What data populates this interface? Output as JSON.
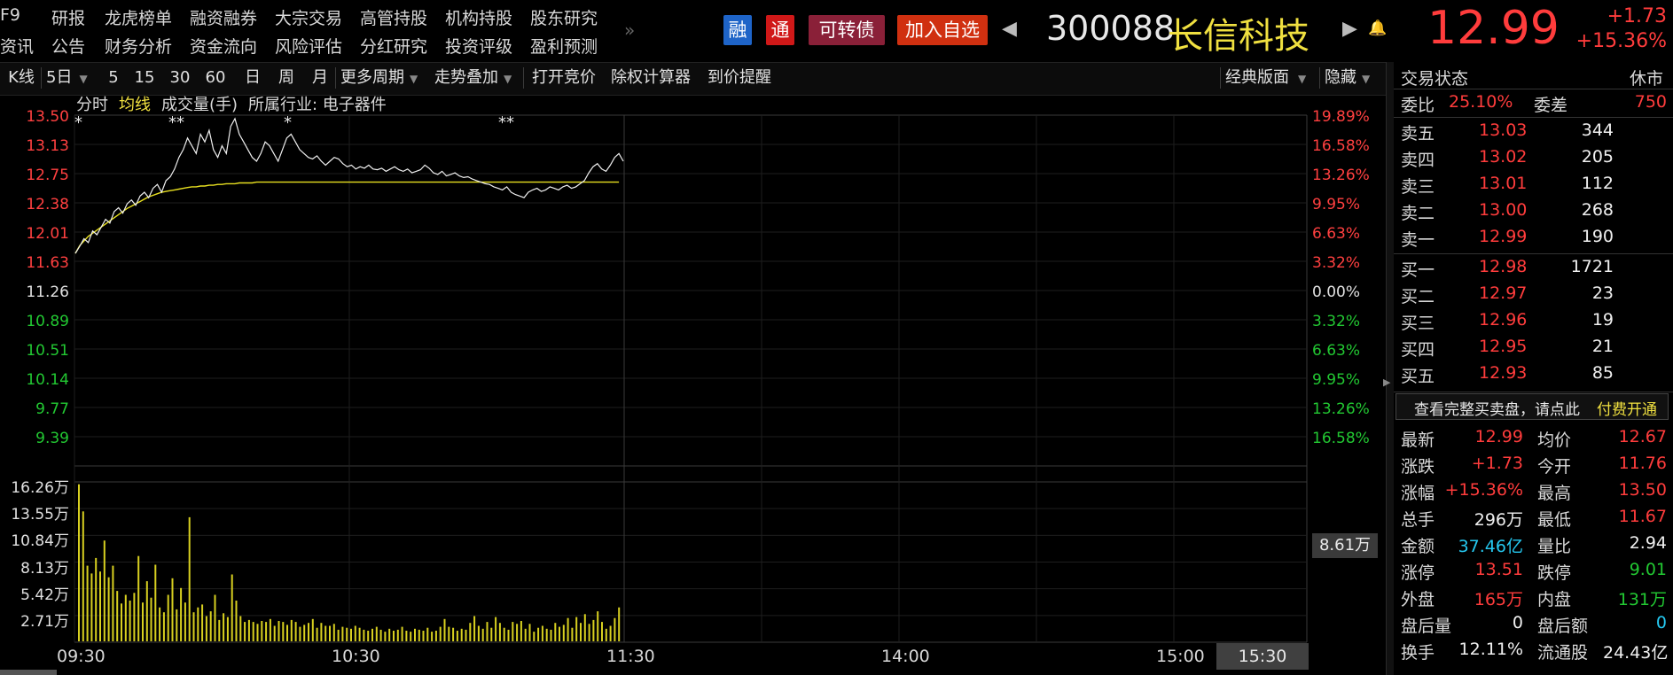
{
  "nav": {
    "row1": [
      "F9",
      "研报",
      "龙虎榜单",
      "融资融券",
      "大宗交易",
      "高管持股",
      "机构持股",
      "股东研究"
    ],
    "row2": [
      "资讯",
      "公告",
      "财务分析",
      "资金流向",
      "风险评估",
      "分红研究",
      "投资评级",
      "盈利预测"
    ],
    "more": "»"
  },
  "header": {
    "badge_rong": "融",
    "badge_tong": "通",
    "badge_convertible": "可转债",
    "add_watchlist": "加入自选",
    "prev_arrow": "◀",
    "next_arrow": "▶",
    "code": "300088",
    "name": "长信科技",
    "bell": "🔔",
    "price": "12.99",
    "change": "+1.73",
    "change_pct": "+15.36%"
  },
  "toolbar": {
    "kline": "K线",
    "period": "5日",
    "p5": "5",
    "p15": "15",
    "p30": "30",
    "p60": "60",
    "day": "日",
    "week": "周",
    "month": "月",
    "more_period": "更多周期",
    "overlay": "走势叠加",
    "auction": "打开竞价",
    "calc": "除权计算器",
    "alert": "到价提醒",
    "layout": "经典版面",
    "hide": "隐藏"
  },
  "chart_header": {
    "tab_timeshare": "分时",
    "tab_avg": "均线",
    "volume_label": "成交量(手)",
    "industry": "所属行业: 电子器件"
  },
  "chart_data": {
    "type": "line",
    "price_axis": [
      "13.50",
      "13.13",
      "12.75",
      "12.38",
      "12.01",
      "11.63",
      "11.26",
      "10.89",
      "10.51",
      "10.14",
      "9.77",
      "9.39"
    ],
    "pct_axis": [
      "19.89%",
      "16.58%",
      "13.26%",
      "9.95%",
      "6.63%",
      "3.32%",
      "0.00%",
      "3.32%",
      "6.63%",
      "9.95%",
      "13.26%",
      "16.58%"
    ],
    "volume_axis": [
      "16.26万",
      "13.55万",
      "10.84万",
      "8.13万",
      "5.42万",
      "2.71万"
    ],
    "volume_marker": "8.61万",
    "time_labels": [
      "09:30",
      "10:30",
      "11:30",
      "14:00",
      "15:00"
    ],
    "current_time": "15:30",
    "ylim": [
      9.2,
      13.6
    ],
    "prev_close": 11.26,
    "price": [
      11.76,
      11.85,
      11.95,
      11.9,
      12.05,
      12.0,
      12.1,
      12.2,
      12.15,
      12.3,
      12.35,
      12.28,
      12.4,
      12.45,
      12.38,
      12.5,
      12.55,
      12.48,
      12.6,
      12.65,
      12.55,
      12.7,
      12.75,
      12.85,
      13.0,
      13.1,
      13.25,
      13.15,
      13.05,
      13.3,
      13.2,
      13.35,
      13.1,
      13.0,
      13.15,
      13.05,
      13.4,
      13.5,
      13.3,
      13.2,
      13.1,
      13.0,
      12.95,
      13.05,
      13.2,
      13.15,
      13.05,
      12.95,
      13.1,
      13.25,
      13.3,
      13.2,
      13.1,
      13.05,
      13.0,
      12.98,
      13.02,
      12.95,
      12.9,
      12.95,
      13.0,
      12.98,
      12.92,
      12.88,
      12.9,
      12.85,
      12.88,
      12.86,
      12.9,
      12.85,
      12.84,
      12.86,
      12.82,
      12.85,
      12.88,
      12.84,
      12.82,
      12.85,
      12.8,
      12.82,
      12.84,
      12.9,
      12.86,
      12.8,
      12.78,
      12.82,
      12.76,
      12.78,
      12.8,
      12.76,
      12.74,
      12.75,
      12.72,
      12.7,
      12.68,
      12.66,
      12.65,
      12.62,
      12.6,
      12.58,
      12.62,
      12.55,
      12.52,
      12.5,
      12.48,
      12.55,
      12.58,
      12.6,
      12.56,
      12.58,
      12.62,
      12.6,
      12.58,
      12.62,
      12.64,
      12.6,
      12.62,
      12.66,
      12.7,
      12.8,
      12.88,
      12.92,
      12.85,
      12.82,
      12.9,
      13.0,
      13.05,
      12.95
    ],
    "avg": [
      11.76,
      11.86,
      11.92,
      11.98,
      12.02,
      12.06,
      12.1,
      12.14,
      12.18,
      12.22,
      12.26,
      12.3,
      12.34,
      12.37,
      12.4,
      12.43,
      12.46,
      12.49,
      12.51,
      12.53,
      12.55,
      12.56,
      12.57,
      12.58,
      12.59,
      12.6,
      12.61,
      12.62,
      12.62,
      12.63,
      12.63,
      12.64,
      12.64,
      12.65,
      12.65,
      12.66,
      12.66,
      12.66,
      12.67,
      12.67,
      12.67,
      12.67,
      12.68,
      12.68,
      12.68,
      12.68,
      12.68,
      12.68,
      12.68,
      12.68,
      12.68,
      12.68,
      12.68,
      12.68,
      12.68,
      12.68,
      12.68,
      12.68,
      12.68,
      12.68,
      12.68,
      12.68,
      12.68,
      12.68,
      12.68,
      12.68,
      12.68,
      12.68,
      12.68,
      12.68,
      12.68,
      12.68,
      12.68,
      12.68,
      12.68,
      12.68,
      12.68,
      12.68,
      12.68,
      12.68,
      12.68,
      12.68,
      12.68,
      12.68,
      12.68,
      12.68,
      12.68,
      12.68,
      12.68,
      12.68,
      12.68,
      12.68,
      12.68,
      12.68,
      12.68,
      12.68,
      12.68,
      12.68,
      12.68,
      12.68,
      12.68,
      12.68,
      12.68,
      12.68,
      12.68,
      12.68,
      12.68,
      12.68,
      12.68,
      12.68,
      12.68,
      12.68,
      12.68,
      12.68,
      12.68,
      12.68,
      12.68,
      12.68,
      12.68,
      12.68,
      12.68,
      12.68,
      12.68,
      12.68,
      12.68,
      12.68,
      12.68
    ],
    "volume_wan": [
      16.2,
      13.4,
      7.8,
      7.0,
      8.6,
      7.2,
      10.4,
      6.6,
      7.8,
      5.2,
      3.9,
      4.8,
      4.2,
      5.0,
      8.8,
      4.0,
      6.2,
      4.5,
      7.9,
      3.5,
      3.0,
      4.8,
      6.5,
      3.3,
      5.5,
      4.0,
      12.8,
      3.0,
      3.5,
      3.8,
      2.6,
      3.1,
      4.8,
      2.2,
      2.9,
      2.5,
      6.9,
      4.2,
      2.6,
      2.0,
      2.2,
      2.0,
      1.8,
      2.1,
      2.0,
      2.3,
      1.6,
      2.1,
      2.0,
      1.7,
      2.2,
      2.0,
      1.5,
      1.7,
      1.9,
      2.3,
      1.4,
      1.9,
      1.6,
      1.6,
      1.8,
      1.2,
      1.5,
      1.4,
      1.3,
      1.6,
      1.4,
      1.2,
      1.1,
      1.3,
      1.5,
      1.2,
      1.0,
      1.3,
      1.1,
      1.2,
      1.5,
      1.1,
      1.0,
      1.3,
      1.2,
      1.1,
      1.4,
      1.0,
      1.1,
      1.5,
      2.3,
      1.5,
      1.4,
      1.1,
      1.3,
      1.2,
      1.9,
      2.6,
      1.6,
      1.3,
      2.0,
      1.4,
      2.5,
      1.9,
      1.4,
      1.2,
      2.0,
      1.8,
      2.1,
      1.3,
      1.8,
      1.0,
      1.4,
      1.6,
      1.3,
      1.2,
      1.9,
      1.5,
      1.7,
      2.4,
      1.4,
      2.5,
      1.9,
      2.8,
      1.8,
      2.2,
      3.1,
      2.0,
      1.3,
      1.6,
      2.4,
      3.5
    ]
  },
  "panel": {
    "status_label": "交易状态",
    "status_value": "休市",
    "weibi_label": "委比",
    "weibi_value": "25.10%",
    "weicha_label": "委差",
    "weicha_value": "750",
    "asks": [
      {
        "label": "卖五",
        "price": "13.03",
        "vol": "344"
      },
      {
        "label": "卖四",
        "price": "13.02",
        "vol": "205"
      },
      {
        "label": "卖三",
        "price": "13.01",
        "vol": "112"
      },
      {
        "label": "卖二",
        "price": "13.00",
        "vol": "268"
      },
      {
        "label": "卖一",
        "price": "12.99",
        "vol": "190"
      }
    ],
    "bids": [
      {
        "label": "买一",
        "price": "12.98",
        "vol": "1721"
      },
      {
        "label": "买二",
        "price": "12.97",
        "vol": "23"
      },
      {
        "label": "买三",
        "price": "12.96",
        "vol": "19"
      },
      {
        "label": "买四",
        "price": "12.95",
        "vol": "21"
      },
      {
        "label": "买五",
        "price": "12.93",
        "vol": "85"
      }
    ],
    "promo_text": "查看完整买卖盘，请点此",
    "promo_link": "付费开通",
    "stats": [
      {
        "l1": "最新",
        "v1": "12.99",
        "c1": "red",
        "l2": "均价",
        "v2": "12.67",
        "c2": "red"
      },
      {
        "l1": "涨跌",
        "v1": "+1.73",
        "c1": "red",
        "l2": "今开",
        "v2": "11.76",
        "c2": "red"
      },
      {
        "l1": "涨幅",
        "v1": "+15.36%",
        "c1": "red",
        "l2": "最高",
        "v2": "13.50",
        "c2": "red"
      },
      {
        "l1": "总手",
        "v1": "296万",
        "c1": "white",
        "l2": "最低",
        "v2": "11.67",
        "c2": "red"
      },
      {
        "l1": "金额",
        "v1": "37.46亿",
        "c1": "cyan",
        "l2": "量比",
        "v2": "2.94",
        "c2": "white"
      },
      {
        "l1": "涨停",
        "v1": "13.51",
        "c1": "red",
        "l2": "跌停",
        "v2": "9.01",
        "c2": "green"
      },
      {
        "l1": "外盘",
        "v1": "165万",
        "c1": "red",
        "l2": "内盘",
        "v2": "131万",
        "c2": "green"
      },
      {
        "l1": "盘后量",
        "v1": "0",
        "c1": "white",
        "l2": "盘后额",
        "v2": "0",
        "c2": "cyan"
      },
      {
        "l1": "换手",
        "v1": "12.11%",
        "c1": "white",
        "l2": "流通股",
        "v2": "24.43亿",
        "c2": "white"
      }
    ]
  }
}
